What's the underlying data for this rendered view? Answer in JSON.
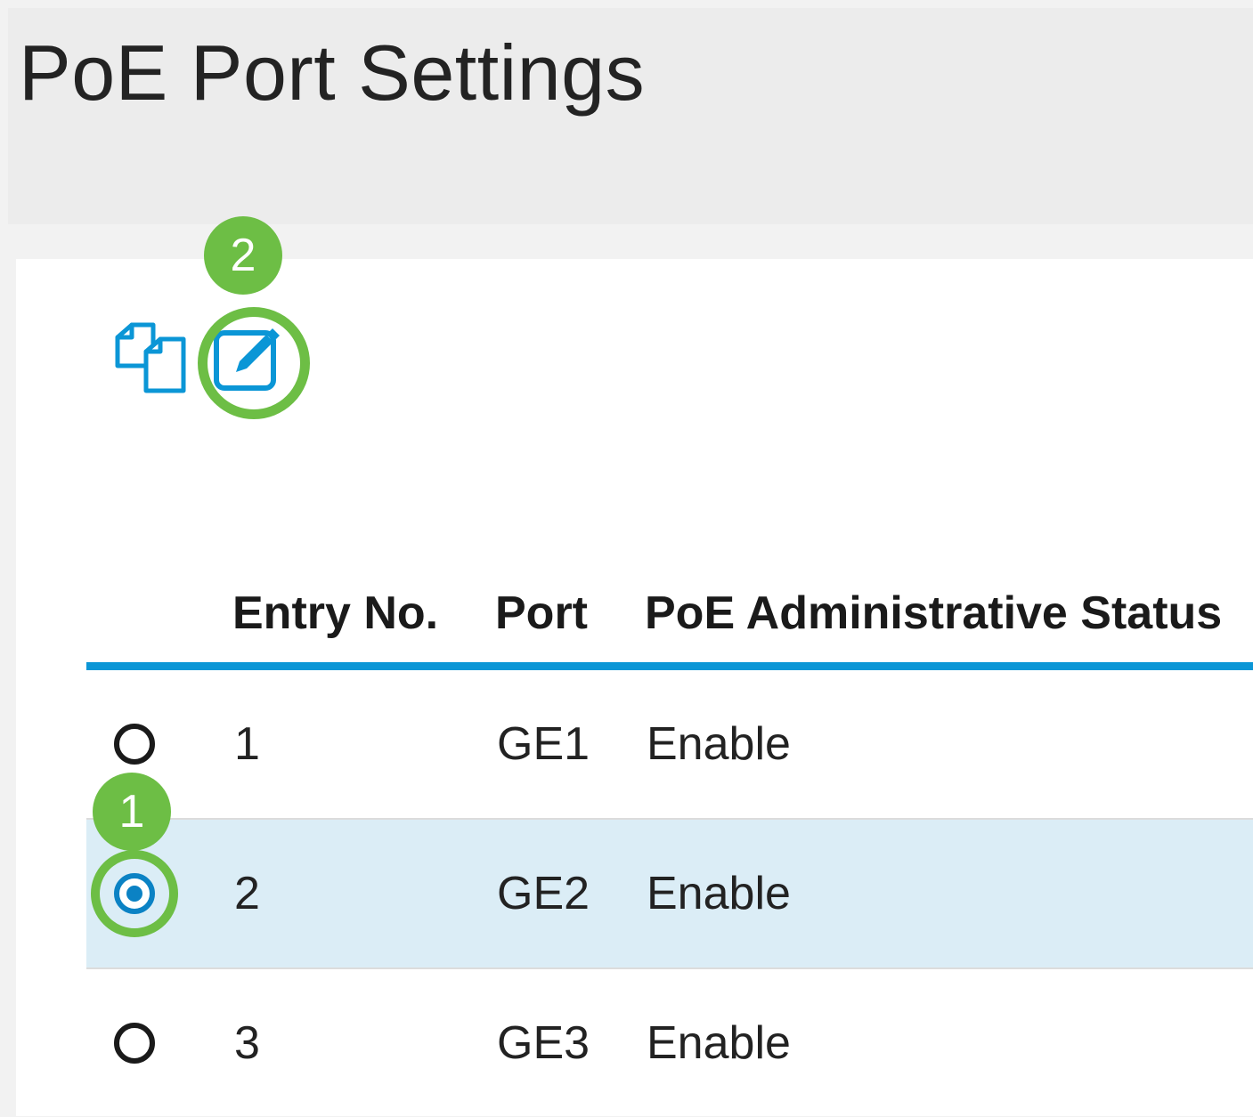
{
  "page": {
    "title": "PoE Port Settings"
  },
  "toolbar": {
    "copy_icon": "copy-settings-icon",
    "edit_icon": "edit-icon"
  },
  "callouts": {
    "edit": "2",
    "row_select": "1"
  },
  "colors": {
    "accent_blue": "#0b96d6",
    "callout_green": "#6dbe45",
    "selected_row": "#dbedf6"
  },
  "table": {
    "columns": [
      "Entry No.",
      "Port",
      "PoE Administrative Status"
    ],
    "rows": [
      {
        "entry": "1",
        "port": "GE1",
        "status": "Enable",
        "selected": false
      },
      {
        "entry": "2",
        "port": "GE2",
        "status": "Enable",
        "selected": true
      },
      {
        "entry": "3",
        "port": "GE3",
        "status": "Enable",
        "selected": false
      }
    ]
  }
}
